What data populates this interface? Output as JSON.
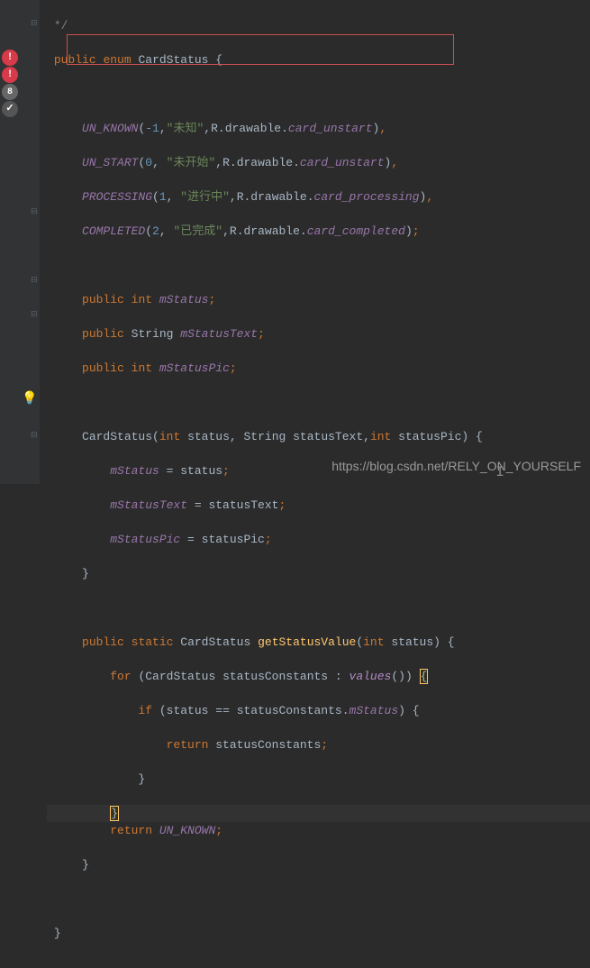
{
  "code": {
    "comment_close": "*/",
    "l1": {
      "kw1": "public",
      "kw2": "enum",
      "name": "CardStatus",
      "brace": "{"
    },
    "e0": {
      "name": "UN_KNOWN",
      "p1": "(",
      "n": "-1",
      "c1": ",",
      "s": "\"未知\"",
      "c2": ",",
      "r": "R.drawable.",
      "f": "card_unstart",
      "p2": ")",
      "end": ","
    },
    "e1": {
      "name": "UN_START",
      "p1": "(",
      "n": "0",
      "c1": ", ",
      "s": "\"未开始\"",
      "c2": ",",
      "r": "R.drawable.",
      "f": "card_unstart",
      "p2": ")",
      "end": ","
    },
    "e2": {
      "name": "PROCESSING",
      "p1": "(",
      "n": "1",
      "c1": ", ",
      "s": "\"进行中\"",
      "c2": ",",
      "r": "R.drawable.",
      "f": "card_processing",
      "p2": ")",
      "end": ","
    },
    "e3": {
      "name": "COMPLETED",
      "p1": "(",
      "n": "2",
      "c1": ", ",
      "s": "\"已完成\"",
      "c2": ",",
      "r": "R.drawable.",
      "f": "card_completed",
      "p2": ")",
      "end": ";"
    },
    "f0": {
      "kw1": "public",
      "kw2": "int",
      "name": "mStatus",
      "end": ";"
    },
    "f1": {
      "kw1": "public",
      "tp": "String",
      "name": "mStatusText",
      "end": ";"
    },
    "f2": {
      "kw1": "public",
      "kw2": "int",
      "name": "mStatusPic",
      "end": ";"
    },
    "ctor": {
      "name": "CardStatus",
      "p1": "(",
      "kw1": "int",
      "a1": "status",
      "c1": ", ",
      "tp2": "String",
      "a2": "statusText",
      "c2": ",",
      "kw3": "int",
      "a3": "statusPic",
      "p2": ")",
      "brace": "{"
    },
    "as0": {
      "lhs": "mStatus",
      "eq": " = ",
      "rhs": "status",
      "end": ";"
    },
    "as1": {
      "lhs": "mStatusText",
      "eq": " = ",
      "rhs": "statusText",
      "end": ";"
    },
    "as2": {
      "lhs": "mStatusPic",
      "eq": " = ",
      "rhs": "statusPic",
      "end": ";"
    },
    "cb": "}",
    "m": {
      "kw1": "public",
      "kw2": "static",
      "tp": "CardStatus",
      "name": "getStatusValue",
      "p1": "(",
      "kw3": "int",
      "arg": "status",
      "p2": ")",
      "brace": "{"
    },
    "for": {
      "kw": "for",
      "p1": "(",
      "tp": "CardStatus",
      "var": "statusConstants",
      "sep": " : ",
      "call": "values",
      "pp": "()",
      "p2": ")",
      "brace": "{"
    },
    "if": {
      "kw": "if",
      "p1": "(",
      "lhs": "status",
      "op": " == ",
      "obj": "statusConstants.",
      "field": "mStatus",
      "p2": ")",
      "brace": "{"
    },
    "ret1": {
      "kw": "return",
      "val": "statusConstants",
      "end": ";"
    },
    "ret2": {
      "kw": "return",
      "val": "UN_KNOWN",
      "end": ";"
    }
  },
  "gutter": {
    "err": "!",
    "count": "8",
    "check": "✓"
  },
  "watermark": "https://blog.csdn.net/RELY_ON_YOURSELF"
}
